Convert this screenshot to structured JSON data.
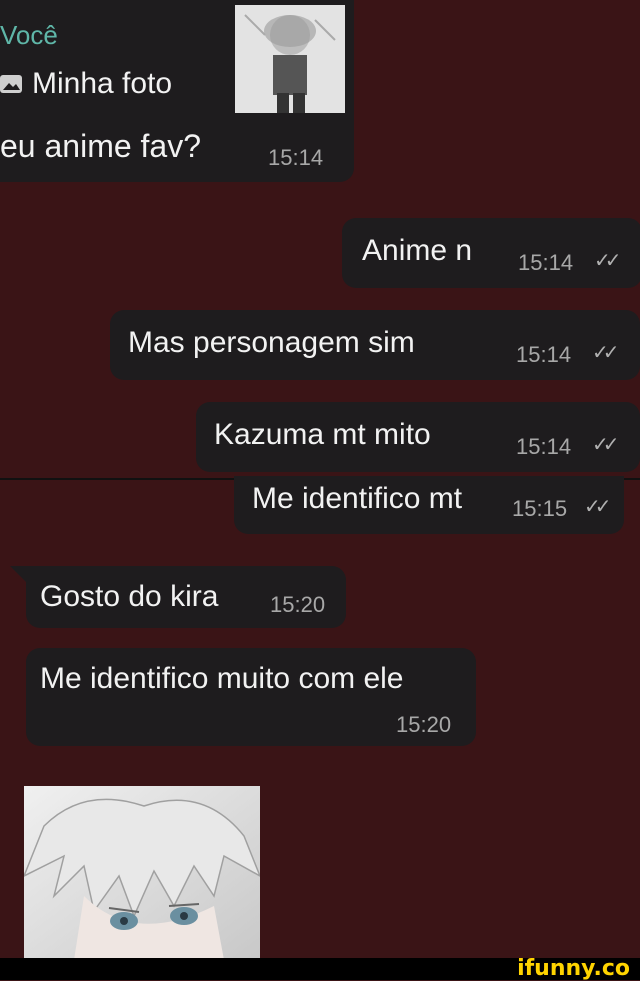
{
  "colors": {
    "background": "#3a1416",
    "bubble": "#1e1c1e",
    "reply_author": "#5fb6a8",
    "watermark_bar": "#000000",
    "watermark_text": "#ffd400"
  },
  "reply_card": {
    "author": "Você",
    "photo_icon": "image-icon",
    "photo_label": "Minha foto",
    "text": "eu anime fav?",
    "time": "15:14"
  },
  "messages": [
    {
      "text": "Anime n",
      "time": "15:14",
      "ticks": "✓✓"
    },
    {
      "text": "Mas personagem sim",
      "time": "15:14",
      "ticks": "✓✓"
    },
    {
      "text": "Kazuma mt mito",
      "time": "15:14",
      "ticks": "✓✓"
    },
    {
      "text": "Me identifico mt",
      "time": "15:15",
      "ticks": "✓✓"
    },
    {
      "text": "Gosto do kira",
      "time": "15:20"
    },
    {
      "text": "Me identifico muito com ele",
      "time": "15:20"
    }
  ],
  "watermark": "ifunny.co"
}
